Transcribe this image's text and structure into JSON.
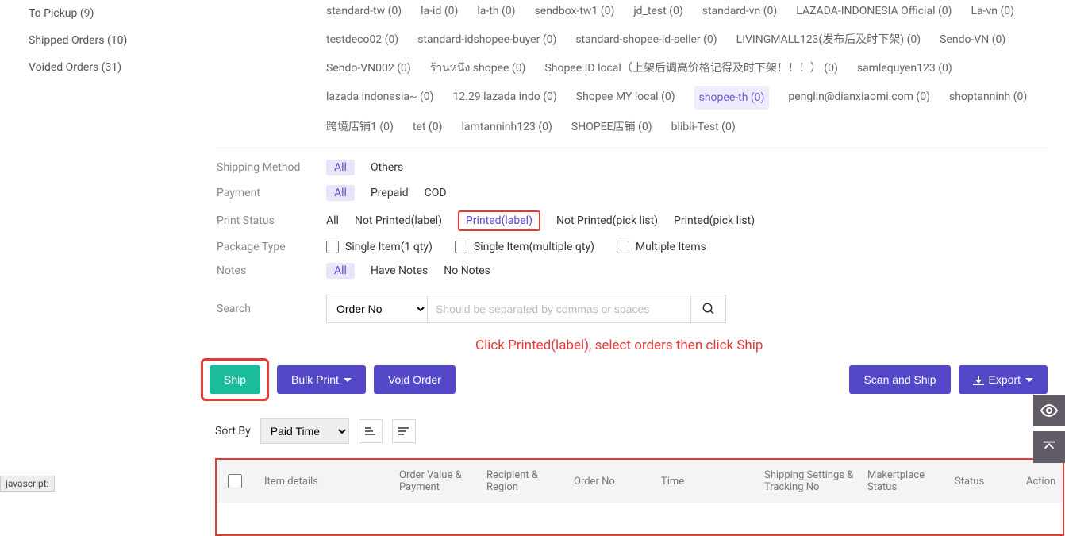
{
  "sidebar": {
    "items": [
      {
        "label": "To Pickup (9)"
      },
      {
        "label": "Shipped Orders (10)"
      },
      {
        "label": "Voided Orders (31)"
      }
    ]
  },
  "stores": [
    "standard-tw (0)",
    "la-id (0)",
    "la-th (0)",
    "sendbox-tw1 (0)",
    "jd_test (0)",
    "standard-vn (0)",
    "LAZADA-INDONESIA Official (0)",
    "La-vn (0)",
    "testdeco02 (0)",
    "standard-idshopee-buyer (0)",
    "standard-shopee-id-seller (0)",
    "LIVINGMALL123(发布后及时下架) (0)",
    "Sendo-VN (0)",
    "Sendo-VN002 (0)",
    "ร้านหนึ่ง shopee (0)",
    "Shopee ID local（上架后调高价格记得及时下架！！！） (0)",
    "samlequyen123 (0)",
    "lazada indonesia~ (0)",
    "12.29 lazada indo (0)",
    "Shopee MY local (0)",
    "shopee-th (0)",
    "penglin@dianxiaomi.com (0)",
    "shoptanninh (0)",
    "跨境店铺1 (0)",
    "tet (0)",
    "lamtanninh123 (0)",
    "SHOPEE店铺 (0)",
    "blibli-Test (0)"
  ],
  "stores_selected_idx": 20,
  "filters": {
    "shipping_method": {
      "label": "Shipping Method",
      "options": [
        "All",
        "Others"
      ],
      "selected": "All"
    },
    "payment": {
      "label": "Payment",
      "options": [
        "All",
        "Prepaid",
        "COD"
      ],
      "selected": "All"
    },
    "print_status": {
      "label": "Print Status",
      "options": [
        "All",
        "Not Printed(label)",
        "Printed(label)",
        "Not Printed(pick list)",
        "Printed(pick list)"
      ],
      "highlight": "Printed(label)"
    },
    "package_type": {
      "label": "Package Type",
      "checks": [
        "Single Item(1 qty)",
        "Single Item(multiple qty)",
        "Multiple Items"
      ]
    },
    "notes": {
      "label": "Notes",
      "options": [
        "All",
        "Have Notes",
        "No Notes"
      ],
      "selected": "All"
    }
  },
  "search": {
    "label": "Search",
    "select": "Order No",
    "placeholder": "Should be separated by commas or spaces"
  },
  "instruction": "Click Printed(label), select orders then click Ship",
  "buttons": {
    "ship": "Ship",
    "bulk_print": "Bulk Print",
    "void_order": "Void Order",
    "scan_ship": "Scan and Ship",
    "export": "Export"
  },
  "sort": {
    "label": "Sort By",
    "value": "Paid Time"
  },
  "table": {
    "headers": [
      "Item details",
      "Order Value & Payment",
      "Recipient & Region",
      "Order No",
      "Time",
      "Shipping Settings & Tracking No",
      "Makertplace Status",
      "Status",
      "Action"
    ]
  },
  "footer_tag": "javascript:"
}
